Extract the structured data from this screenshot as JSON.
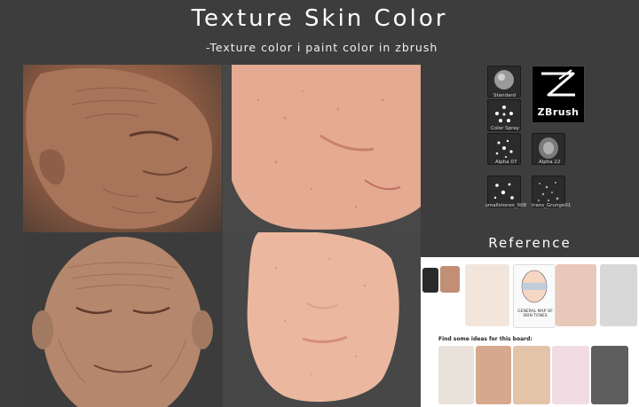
{
  "header": {
    "title": "Texture Skin Color",
    "subtitle": "-Texture color i paint color in zbrush"
  },
  "photos": [
    {
      "name": "old-face-sculpt-side",
      "tone": "#9a6a50"
    },
    {
      "name": "flat-skin-texture-side",
      "tone": "#e3a891"
    },
    {
      "name": "old-face-sculpt-front",
      "tone": "#b88a70"
    },
    {
      "name": "flat-skin-texture-front",
      "tone": "#e8b49c"
    }
  ],
  "brush_panel": {
    "items": [
      {
        "label": "Standard",
        "icon": "standard-brush-icon"
      },
      {
        "label": "Color Spray",
        "icon": "color-spray-icon"
      },
      {
        "label": "Alpha 07",
        "icon": "alpha-07-icon"
      },
      {
        "label": "Alpha 22",
        "icon": "alpha-22-icon"
      },
      {
        "label": "smallstones_008",
        "icon": "smallstones-icon"
      },
      {
        "label": "trans_Grunge01",
        "icon": "grunge-icon"
      }
    ],
    "logo_text": "ZBrush"
  },
  "reference": {
    "title": "Reference",
    "board_caption": "Find some ideas for this board:",
    "map_label": "GENERAL MAP OF SKIN TONES"
  },
  "colors": {
    "background": "#3d3d3d",
    "skin_dark": "#8a5a42",
    "skin_light": "#e8b49c"
  }
}
